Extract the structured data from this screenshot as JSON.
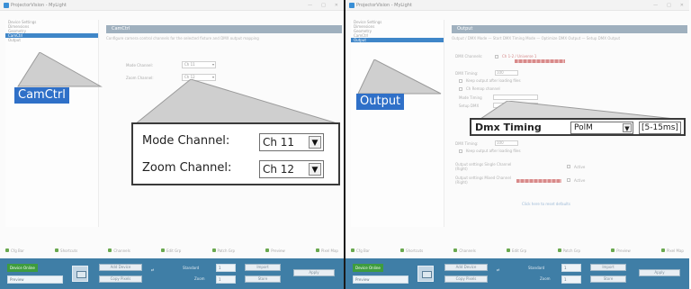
{
  "window": {
    "title": "ProjectorVision - MyLight",
    "buttons": [
      "—",
      "□",
      "✕"
    ]
  },
  "left": {
    "sidebar": {
      "items": [
        {
          "label": "Device Settings",
          "selected": false
        },
        {
          "label": "Dimensions",
          "selected": false
        },
        {
          "label": "Geometry",
          "selected": false
        },
        {
          "label": "CamCtrl",
          "selected": true
        },
        {
          "label": "Output",
          "selected": false
        }
      ]
    },
    "section_title": "CamCtrl",
    "section_desc": "Configure camera control channels for the selected fixture and DMX output mapping",
    "fields": [
      {
        "label": "Mode Channel:",
        "value": "Ch 11"
      },
      {
        "label": "Zoom Channel:",
        "value": "Ch 12"
      }
    ],
    "callout_label": "CamCtrl",
    "zoom_fields": [
      {
        "label": "Mode Channel:",
        "value": "Ch 11"
      },
      {
        "label": "Zoom Channel:",
        "value": "Ch 12"
      }
    ]
  },
  "right": {
    "sidebar": {
      "items": [
        {
          "label": "Device Settings",
          "selected": false
        },
        {
          "label": "Dimensions",
          "selected": false
        },
        {
          "label": "Geometry",
          "selected": false
        },
        {
          "label": "CamCtrl",
          "selected": false
        },
        {
          "label": "Output",
          "selected": true
        }
      ]
    },
    "section_title": "Output",
    "section_desc": "Output / DMX Mode   —   Start DMX Timing Mode   —   Optimize DMX Output   —   Setup DMX Output",
    "rows": [
      {
        "label": "DMX Channels:",
        "value": "Ch 1-2 / Universe 1"
      },
      {
        "label": "DMX Timing:",
        "value": "100"
      },
      {
        "label": "Keep output after loading files",
        "value": ""
      },
      {
        "label": "Ch Remap channel",
        "value": ""
      },
      {
        "label": "Mode Timing",
        "value": ""
      },
      {
        "label": "Setup DMX",
        "value": ""
      }
    ],
    "callout_label": "Output",
    "dmx_box": {
      "label": "Dmx Timing",
      "mode": "PolM",
      "value": "[5-15ms]"
    },
    "lower_rows": [
      {
        "label": "DMX Timing:",
        "value": "100"
      },
      {
        "label": "Keep output after loading files",
        "value": ""
      },
      {
        "label": "Output settings Single Channel (Right)",
        "value": "Active"
      },
      {
        "label": "Output settings Mixed Channel (Right)",
        "value": "Active"
      }
    ],
    "link": "Click here to reset defaults"
  },
  "bottom_strip": [
    "Cfg Bar",
    "Shortcuts",
    "Channels",
    "Edit Grp",
    "Patch Grp",
    "Preview",
    "Preview",
    "Pixel Map"
  ],
  "footer": {
    "badge": "Device Online",
    "sub": "Preview",
    "btn_a1": "Add Device",
    "btn_a2": "Copy Pixels",
    "label_mode": "Standard",
    "label_zoom": "Zoom",
    "sel_a": "1",
    "sel_b": "1",
    "btn_b1": "Import",
    "btn_b2": "Store",
    "btn_ok": "Apply"
  }
}
